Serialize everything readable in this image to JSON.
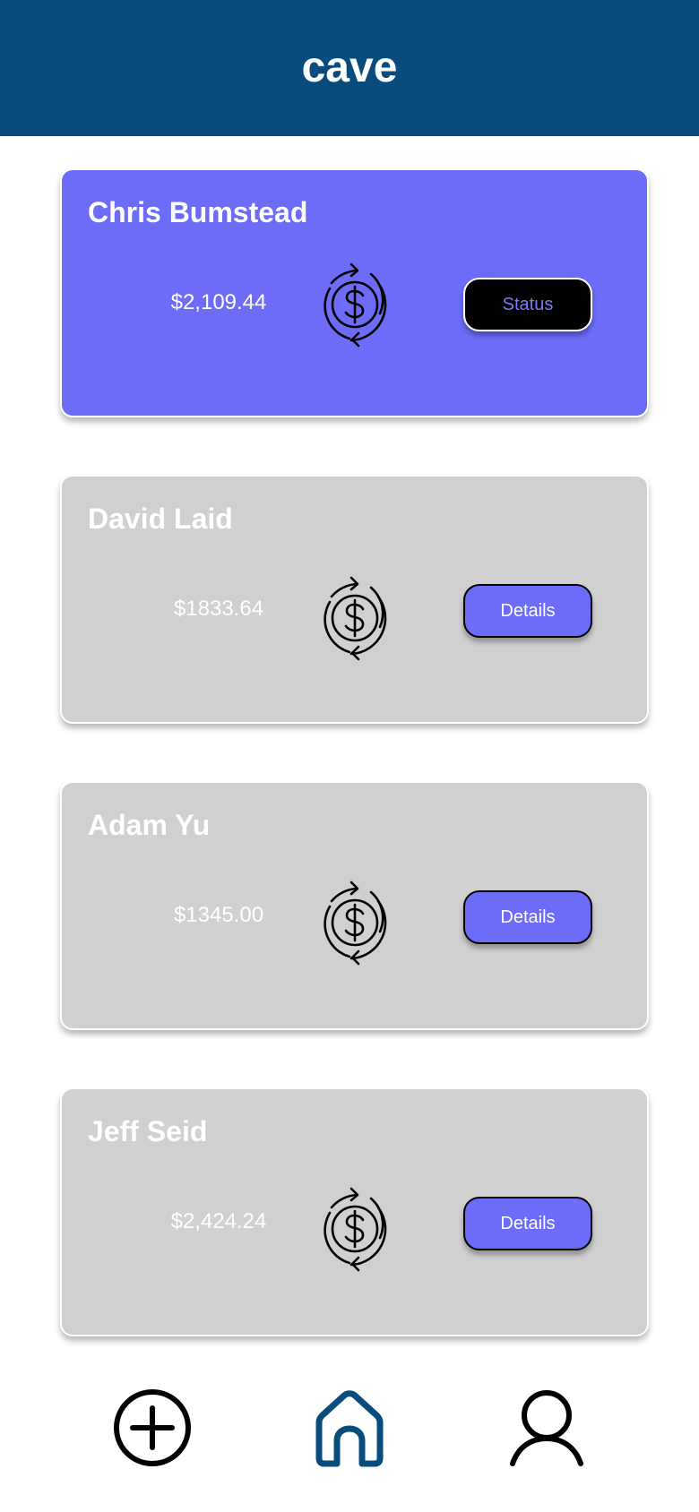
{
  "header": {
    "title": "cave"
  },
  "cards": [
    {
      "name": "Chris Bumstead",
      "amount": "$2,109.44",
      "button_label": "Status",
      "active": true
    },
    {
      "name": "David Laid",
      "amount": "$1833.64",
      "button_label": "Details",
      "active": false
    },
    {
      "name": "Adam Yu",
      "amount": "$1345.00",
      "button_label": "Details",
      "active": false
    },
    {
      "name": "Jeff Seid",
      "amount": "$2,424.24",
      "button_label": "Details",
      "active": false
    }
  ],
  "card_icon": "dollar-refresh-icon",
  "bottom_nav": [
    {
      "icon": "plus-circle-icon",
      "color": "#000000"
    },
    {
      "icon": "home-icon",
      "color": "#084b7d",
      "active": true
    },
    {
      "icon": "user-icon",
      "color": "#000000"
    }
  ],
  "colors": {
    "header_bg": "#084b7d",
    "accent": "#6c6cf8",
    "inactive_card": "#d0d0d0",
    "status_button_bg": "#000000"
  }
}
